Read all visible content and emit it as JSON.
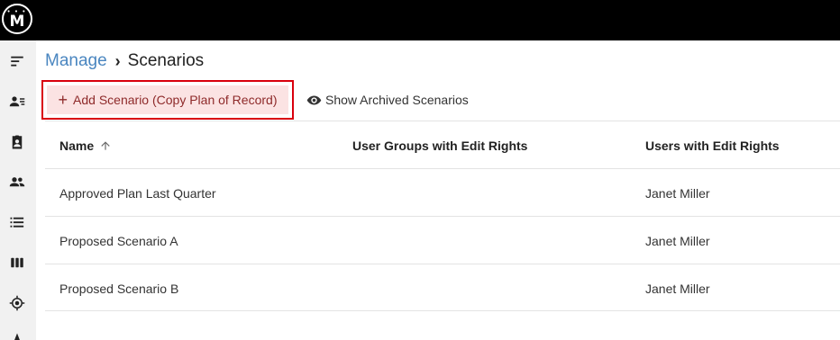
{
  "app": {
    "logo_text": "M"
  },
  "sidebar": {
    "items": [
      {
        "icon": "sort-lines-icon"
      },
      {
        "icon": "user-list-icon"
      },
      {
        "icon": "contact-badge-icon"
      },
      {
        "icon": "people-icon"
      },
      {
        "icon": "list-icon"
      },
      {
        "icon": "columns-icon"
      },
      {
        "icon": "target-icon"
      },
      {
        "icon": "navigation-icon"
      }
    ]
  },
  "breadcrumb": {
    "parent": "Manage",
    "separator": "›",
    "current": "Scenarios"
  },
  "toolbar": {
    "add_label": "Add Scenario (Copy Plan of Record)",
    "archived_label": "Show Archived Scenarios"
  },
  "table": {
    "columns": [
      "Name",
      "User Groups with Edit Rights",
      "Users with Edit Rights"
    ],
    "rows": [
      {
        "name": "Approved Plan Last Quarter",
        "groups": "",
        "users": "Janet Miller"
      },
      {
        "name": "Proposed Scenario A",
        "groups": "",
        "users": "Janet Miller"
      },
      {
        "name": "Proposed Scenario B",
        "groups": "",
        "users": "Janet Miller"
      }
    ]
  },
  "colors": {
    "accent": "#4a86c0",
    "highlight_border": "#d9000d",
    "highlight_fill": "#fbe3e3"
  }
}
